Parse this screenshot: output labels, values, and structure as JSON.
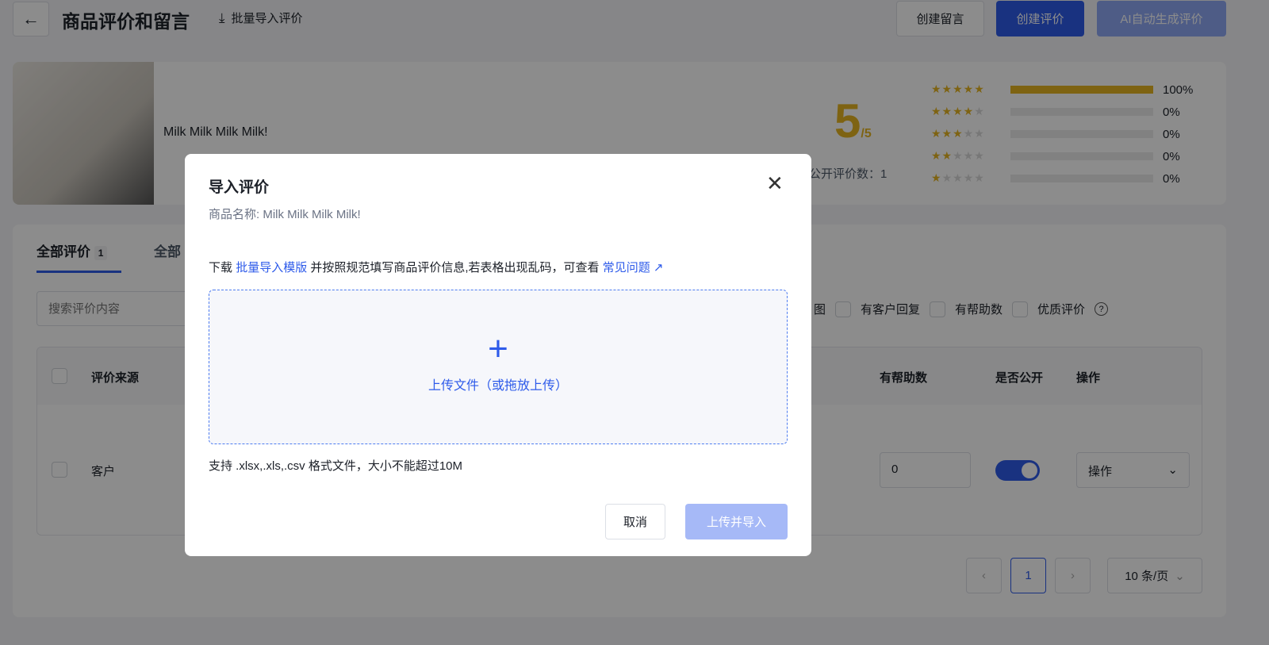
{
  "header": {
    "title": "商品评价和留言",
    "bulk_import": "批量导入评价",
    "create_message": "创建留言",
    "create_review": "创建评价",
    "ai_generate": "AI自动生成评价"
  },
  "product": {
    "name": "Milk Milk Milk Milk!",
    "score": "5",
    "score_max": "/5",
    "public_count_label": "公开评价数：1",
    "distribution": [
      {
        "stars": 5,
        "percent": 100,
        "label": "100%"
      },
      {
        "stars": 4,
        "percent": 0,
        "label": "0%"
      },
      {
        "stars": 3,
        "percent": 0,
        "label": "0%"
      },
      {
        "stars": 2,
        "percent": 0,
        "label": "0%"
      },
      {
        "stars": 1,
        "percent": 0,
        "label": "0%"
      }
    ]
  },
  "tabs": [
    {
      "label": "全部评价",
      "count": "1"
    },
    {
      "label": "全部"
    }
  ],
  "search": {
    "placeholder": "搜索评价内容"
  },
  "filters": [
    "图",
    "有客户回复",
    "有帮助数",
    "优质评价"
  ],
  "table": {
    "headers": [
      "评价来源",
      "有帮助数",
      "是否公开",
      "操作"
    ],
    "rows": [
      {
        "source": "客户",
        "helpful": "0",
        "public": true,
        "action": "操作"
      }
    ]
  },
  "pagination": {
    "page": "1",
    "page_size": "10 条/页"
  },
  "modal": {
    "title": "导入评价",
    "product_label": "商品名称: Milk Milk Milk Milk!",
    "desc_prefix": "下载",
    "template_link": "批量导入模版",
    "desc_middle": "并按照规范填写商品评价信息,若表格出现乱码，可查看",
    "faq_link": "常见问题",
    "upload_label": "上传文件（或拖放上传）",
    "support_note": "支持 .xlsx,.xls,.csv 格式文件，大小不能超过10M",
    "cancel": "取消",
    "submit": "上传并导入"
  },
  "colors": {
    "primary": "#2e5bea",
    "star": "#e6b422"
  }
}
